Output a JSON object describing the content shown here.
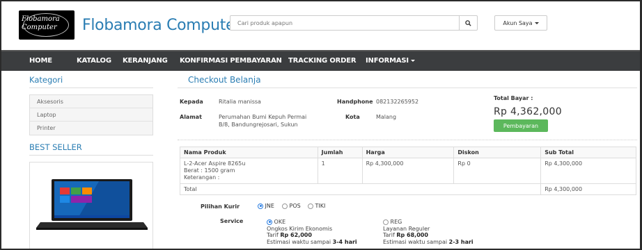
{
  "header": {
    "logo_text": "Flobamora Computer",
    "brand": "Flobamora Computer",
    "search_placeholder": "Cari produk apapun",
    "account_label": "Akun Saya"
  },
  "nav": {
    "items": [
      "HOME",
      "KATALOG",
      "KERANJANG",
      "KONFIRMASI PEMBAYARAN",
      "TRACKING ORDER",
      "INFORMASI"
    ]
  },
  "sidebar": {
    "category_title": "Kategori",
    "categories": [
      "Aksesoris",
      "Laptop",
      "Printer"
    ],
    "best_seller_title": "BEST SELLER"
  },
  "checkout": {
    "title": "Checkout Belanja",
    "kepada_label": "Kepada",
    "kepada_value": "Ritalia manissa",
    "handphone_label": "Handphone",
    "handphone_value": "082132265952",
    "alamat_label": "Alamat",
    "alamat_value_1": "Perumahan Bumi Kepuh Permai",
    "alamat_value_2": "B/8, Bandungrejosari, Sukun",
    "kota_label": "Kota",
    "kota_value": "Malang",
    "total_label": "Total Bayar :",
    "total_value": "Rp 4,362,000",
    "pay_button": "Pembayaran"
  },
  "order_table": {
    "headers": [
      "Nama Produk",
      "Jumlah",
      "Harga",
      "Diskon",
      "Sub Total"
    ],
    "row": {
      "product_line1": "L-2-Acer Aspire 8265u",
      "product_line2": "Berat : 1500 gram",
      "product_line3": "Keterangan :",
      "qty": "1",
      "price": "Rp 4,300,000",
      "discount": "Rp 0",
      "subtotal": "Rp 4,300,000"
    },
    "total_label": "Total",
    "total_value": "Rp 4,300,000"
  },
  "shipping": {
    "courier_label": "Pilihan Kurir",
    "couriers": [
      "JNE",
      "POS",
      "TIKI"
    ],
    "selected_courier": "JNE",
    "service_label": "Service",
    "services": [
      {
        "code": "OKE",
        "name": "Ongkos Kirim Ekonomis",
        "tarif_prefix": "Tarif",
        "tarif": "Rp 62,000",
        "est_prefix": "Estimasi waktu sampai",
        "est": "3-4 hari",
        "selected": true
      },
      {
        "code": "REG",
        "name": "Layanan Reguler",
        "tarif_prefix": "Tarif",
        "tarif": "Rp 68,000",
        "est_prefix": "Estimasi waktu sampai",
        "est": "2-3 hari",
        "selected": false
      }
    ]
  },
  "colors": {
    "brand_blue": "#2a7db3",
    "nav_bg": "#3b3d3f",
    "pay_green": "#5cb85c"
  }
}
